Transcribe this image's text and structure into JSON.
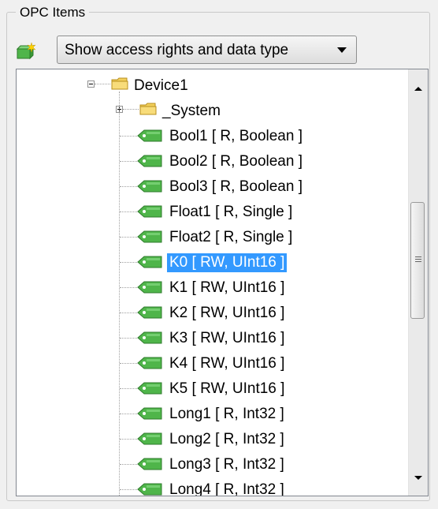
{
  "group": {
    "title": "OPC Items"
  },
  "toolbar": {
    "icon": "add-item-icon"
  },
  "dropdown": {
    "selected": "Show access rights and data type"
  },
  "tree": {
    "root": {
      "label": "Device1",
      "icon": "folder-icon",
      "expanded": true
    },
    "folder": {
      "label": "_System",
      "icon": "folder-icon",
      "expanded": false
    },
    "items": [
      {
        "label": "Bool1   [ R, Boolean ]"
      },
      {
        "label": "Bool2   [ R, Boolean ]"
      },
      {
        "label": "Bool3   [ R, Boolean ]"
      },
      {
        "label": "Float1   [ R, Single ]"
      },
      {
        "label": "Float2   [ R, Single ]"
      },
      {
        "label": "K0   [ RW, UInt16 ]",
        "selected": true
      },
      {
        "label": "K1   [ RW, UInt16 ]"
      },
      {
        "label": "K2   [ RW, UInt16 ]"
      },
      {
        "label": "K3   [ RW, UInt16 ]"
      },
      {
        "label": "K4   [ RW, UInt16 ]"
      },
      {
        "label": "K5   [ RW, UInt16 ]"
      },
      {
        "label": "Long1   [ R, Int32 ]"
      },
      {
        "label": "Long2   [ R, Int32 ]"
      },
      {
        "label": "Long3   [ R, Int32 ]"
      },
      {
        "label": "Long4   [ R, Int32 ]"
      }
    ]
  },
  "colors": {
    "selection": "#3399ff",
    "tag_fill": "#4fb54a"
  }
}
